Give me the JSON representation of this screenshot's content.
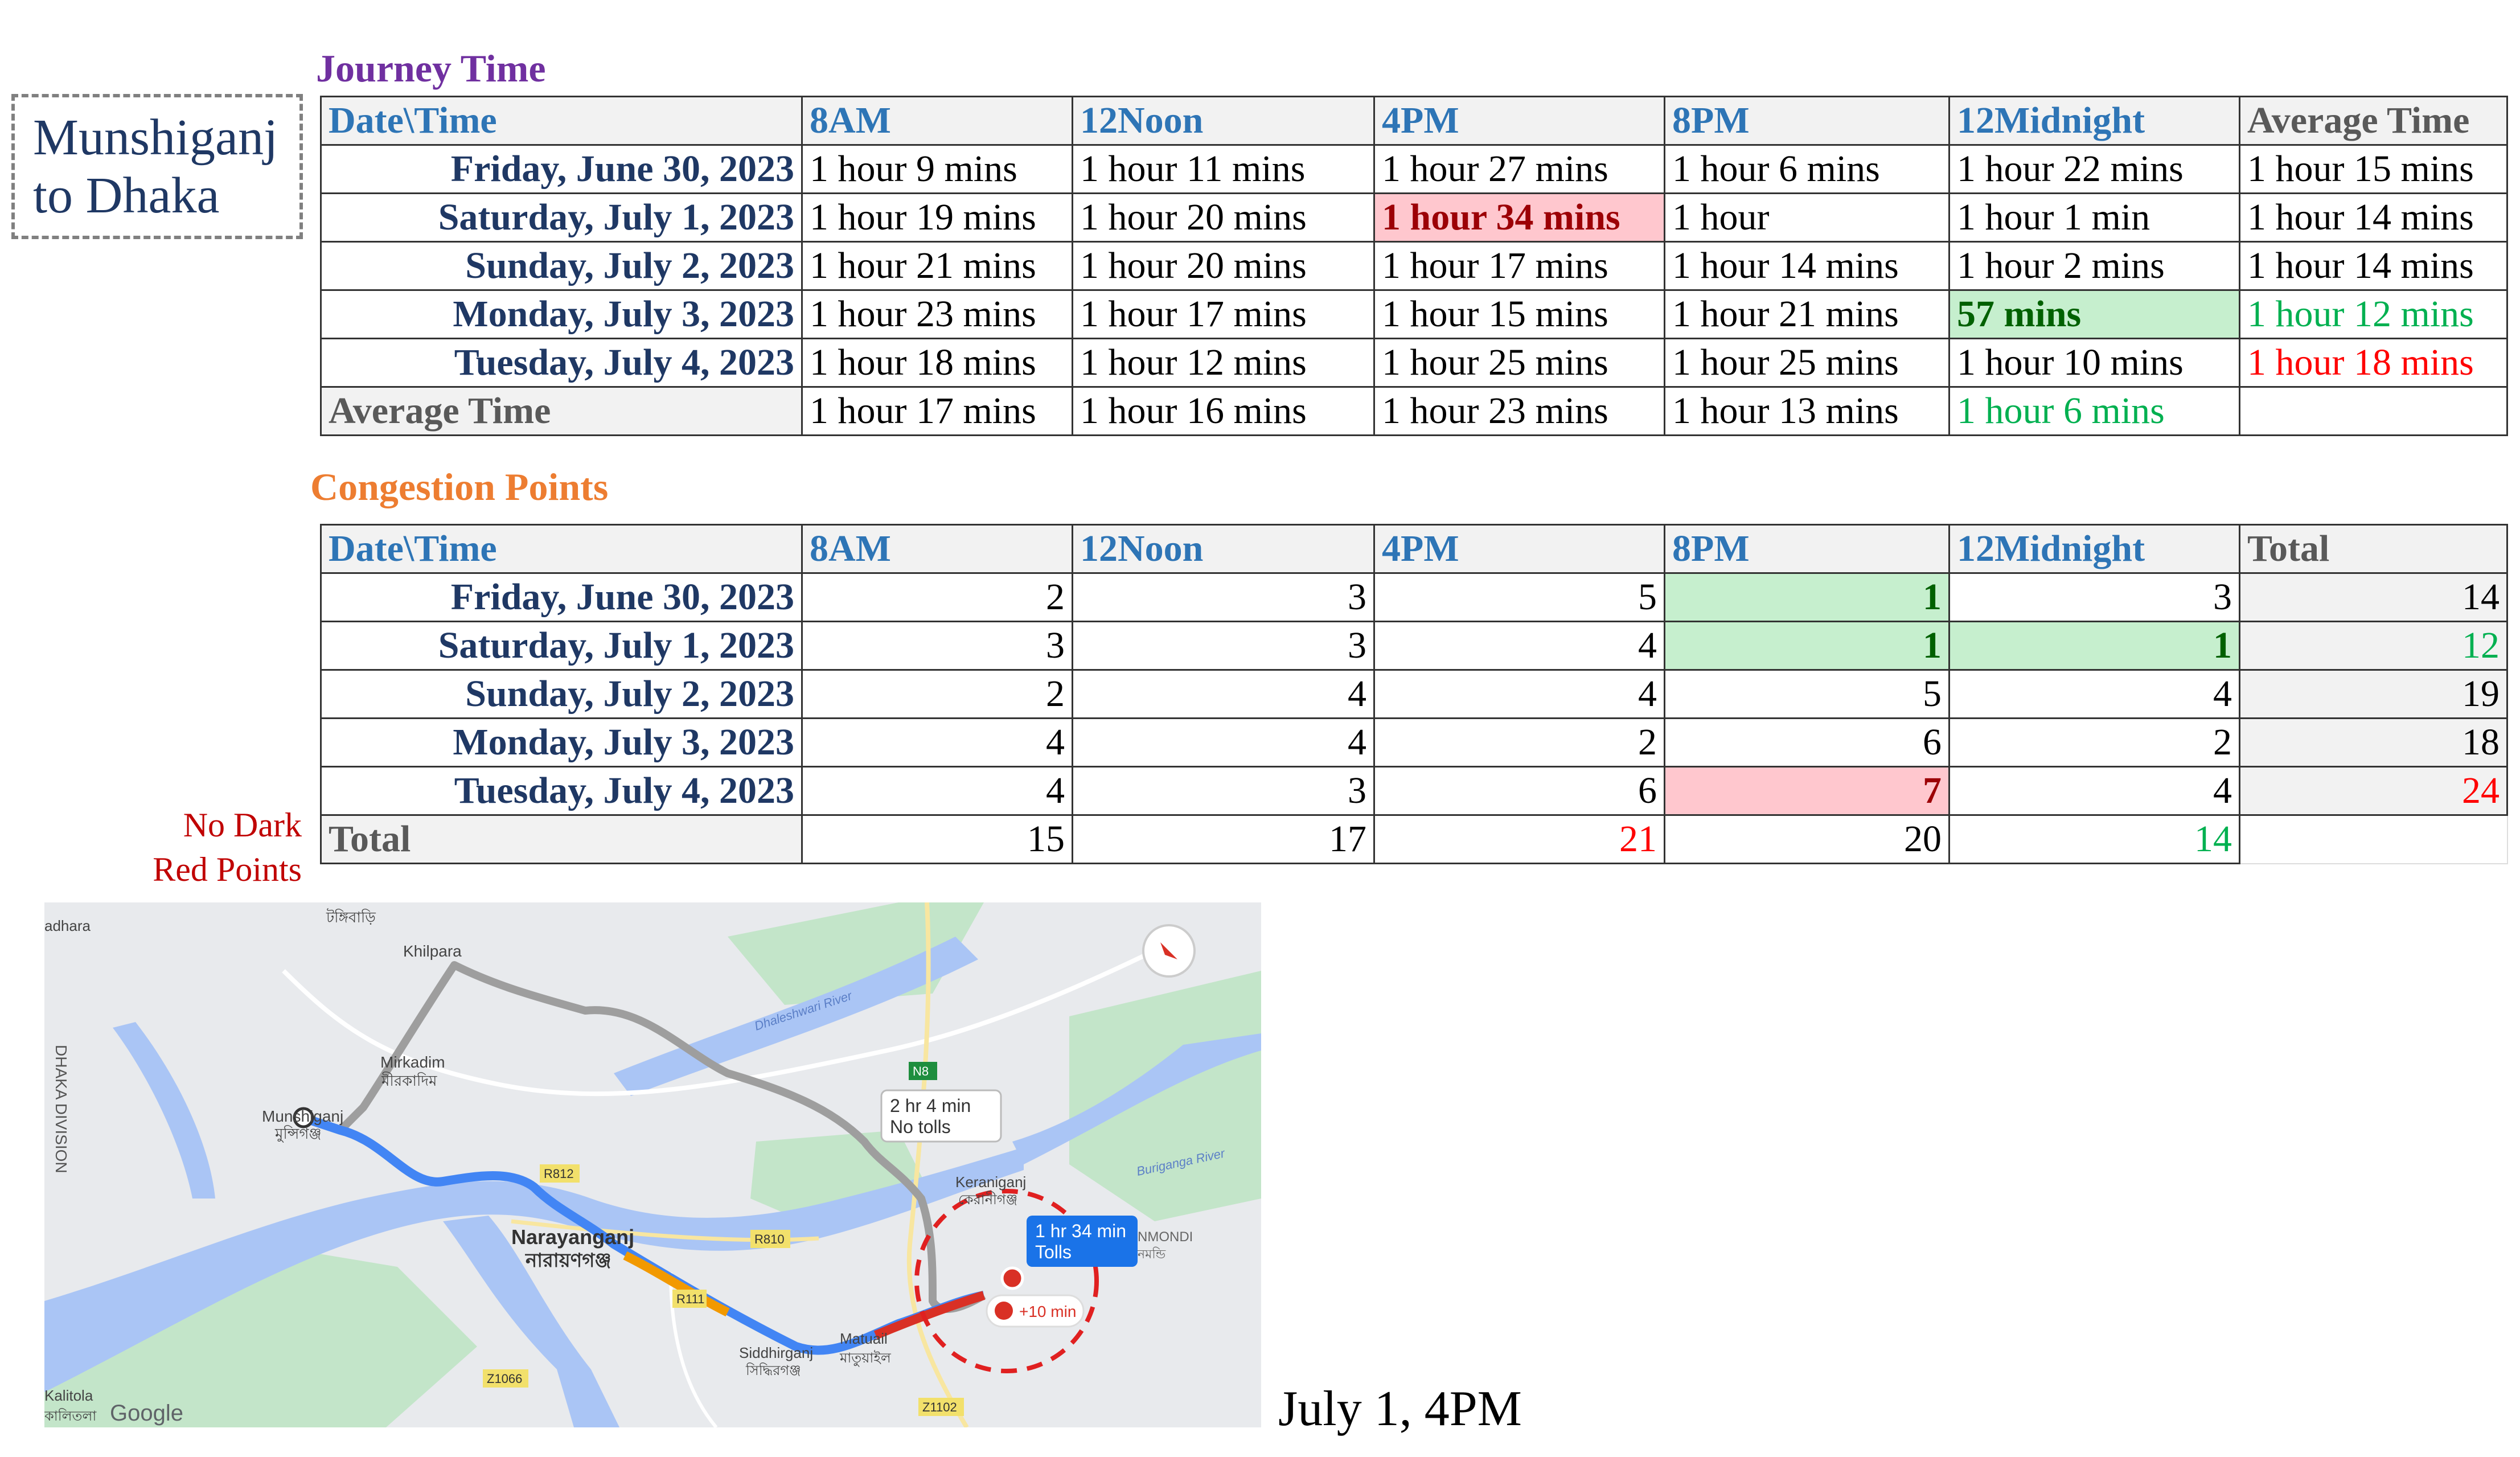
{
  "route_label": [
    "Munshiganj",
    "to Dhaka"
  ],
  "journey_time": {
    "title": "Journey Time",
    "headers": [
      "Date\\Time",
      "8AM",
      "12Noon",
      "4PM",
      "8PM",
      "12Midnight",
      "Average Time"
    ],
    "rows": [
      {
        "date": "Friday, June 30, 2023",
        "cells": [
          "1 hour 9 mins",
          "1 hour 11 mins",
          "1 hour 27 mins",
          "1 hour 6 mins",
          "1 hour 22 mins"
        ],
        "average": "1 hour 15 mins"
      },
      {
        "date": "Saturday, July 1, 2023",
        "cells": [
          "1 hour 19 mins",
          "1 hour 20 mins",
          "1 hour 34 mins",
          "1 hour",
          "1 hour 1 min"
        ],
        "average": "1 hour 14 mins"
      },
      {
        "date": "Sunday, July 2, 2023",
        "cells": [
          "1 hour 21 mins",
          "1 hour 20 mins",
          "1 hour 17 mins",
          "1 hour 14 mins",
          "1 hour 2 mins"
        ],
        "average": "1 hour 14 mins"
      },
      {
        "date": "Monday, July 3, 2023",
        "cells": [
          "1 hour 23 mins",
          "1 hour 17 mins",
          "1 hour 15 mins",
          "1 hour 21 mins",
          "57 mins"
        ],
        "average": "1 hour 12 mins"
      },
      {
        "date": "Tuesday, July 4, 2023",
        "cells": [
          "1 hour 18 mins",
          "1 hour 12 mins",
          "1 hour 25 mins",
          "1 hour 25 mins",
          "1 hour 10 mins"
        ],
        "average": "1 hour 18 mins"
      }
    ],
    "footer": {
      "label": "Average Time",
      "cells": [
        "1 hour 17 mins",
        "1 hour 16 mins",
        "1 hour 23 mins",
        "1 hour 13 mins",
        "1 hour 6 mins"
      ],
      "last": ""
    }
  },
  "congestion_points": {
    "title": "Congestion Points",
    "headers": [
      "Date\\Time",
      "8AM",
      "12Noon",
      "4PM",
      "8PM",
      "12Midnight",
      "Total"
    ],
    "rows": [
      {
        "date": "Friday, June 30, 2023",
        "cells": [
          "2",
          "3",
          "5",
          "1",
          "3"
        ],
        "total": "14"
      },
      {
        "date": "Saturday, July 1, 2023",
        "cells": [
          "3",
          "3",
          "4",
          "1",
          "1"
        ],
        "total": "12"
      },
      {
        "date": "Sunday, July 2, 2023",
        "cells": [
          "2",
          "4",
          "4",
          "5",
          "4"
        ],
        "total": "19"
      },
      {
        "date": "Monday, July 3, 2023",
        "cells": [
          "4",
          "4",
          "2",
          "6",
          "2"
        ],
        "total": "18"
      },
      {
        "date": "Tuesday, July 4, 2023",
        "cells": [
          "4",
          "3",
          "6",
          "7",
          "4"
        ],
        "total": "24"
      }
    ],
    "footer": {
      "label": "Total",
      "cells": [
        "15",
        "17",
        "21",
        "20",
        "14"
      ],
      "last": ""
    }
  },
  "note": [
    "No Dark",
    "Red Points"
  ],
  "map": {
    "places": [
      "adhara",
      "টঙ্গিবাড়ি",
      "Khilpara",
      "Mirkadim",
      "মীরকাদিম",
      "Munshiganj",
      "মুন্সিগঞ্জ",
      "DHAKA DIVISION",
      "Dhaleshwari River",
      "Buriganga River",
      "Keraniganj",
      "কেরানীগঞ্জ",
      "Narayanganj",
      "নারায়ণগঞ্জ",
      "Siddhirganj",
      "সিদ্ধিরগঞ্জ",
      "Matuail",
      "মাতুয়াইল",
      "Kalitola",
      "কালিতলা",
      "NMONDI",
      "নমন্ডি",
      "Google"
    ],
    "roads": [
      "N8",
      "R812",
      "R810",
      "R111",
      "Z1066",
      "Z1102"
    ],
    "alt_route": {
      "time": "2 hr 4 min",
      "note": "No tolls"
    },
    "main_route": {
      "time": "1 hr 34 min",
      "note": "Tolls"
    },
    "delay": "+10 min",
    "colors": {
      "route": "#4285f4",
      "route_slow": "#f29900",
      "route_jam": "#d93025",
      "alt_route": "#9e9e9e",
      "water": "#aac5f5",
      "land": "#e8eaed",
      "green": "#c3e5c9",
      "circle": "#e02020"
    }
  },
  "caption": "July 1, 4PM"
}
